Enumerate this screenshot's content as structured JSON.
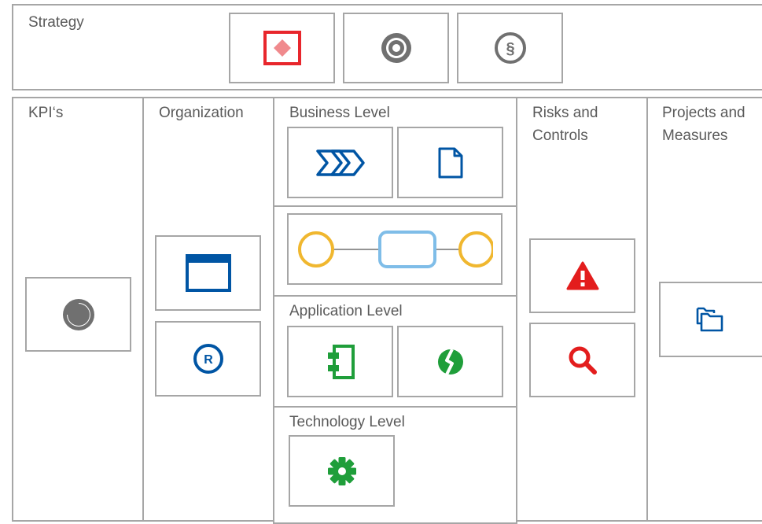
{
  "strategy": {
    "label": "Strategy",
    "icons": [
      "diamond-icon",
      "target-icon",
      "paragraph-icon"
    ]
  },
  "columns": {
    "kpis": {
      "label": "KPI‘s",
      "icons": [
        "pie-chart-icon"
      ]
    },
    "organization": {
      "label": "Organization",
      "icons": [
        "window-icon",
        "role-icon"
      ]
    },
    "business_level": {
      "label": "Business Level",
      "icons": [
        "value-chain-icon",
        "document-icon"
      ]
    },
    "process_flow": {
      "icons": [
        "event-circle-icon",
        "function-rectangle-icon",
        "event-circle-icon"
      ]
    },
    "application_level": {
      "label": "Application Level",
      "icons": [
        "component-icon",
        "interface-icon"
      ]
    },
    "technology_level": {
      "label": "Technology Level",
      "icons": [
        "gear-icon"
      ]
    },
    "risks_controls": {
      "label": "Risks and\nControls",
      "icons": [
        "warning-icon",
        "search-icon"
      ]
    },
    "projects_measures": {
      "label": "Projects and\nMeasures",
      "icons": [
        "folders-icon"
      ]
    }
  },
  "colors": {
    "border": "#a6a6a6",
    "red": "#e8262c",
    "blue": "#0055a4",
    "green": "#1f9e3a",
    "gray": "#707070",
    "yellow": "#f0b72f",
    "light_blue": "#7fbde8"
  }
}
